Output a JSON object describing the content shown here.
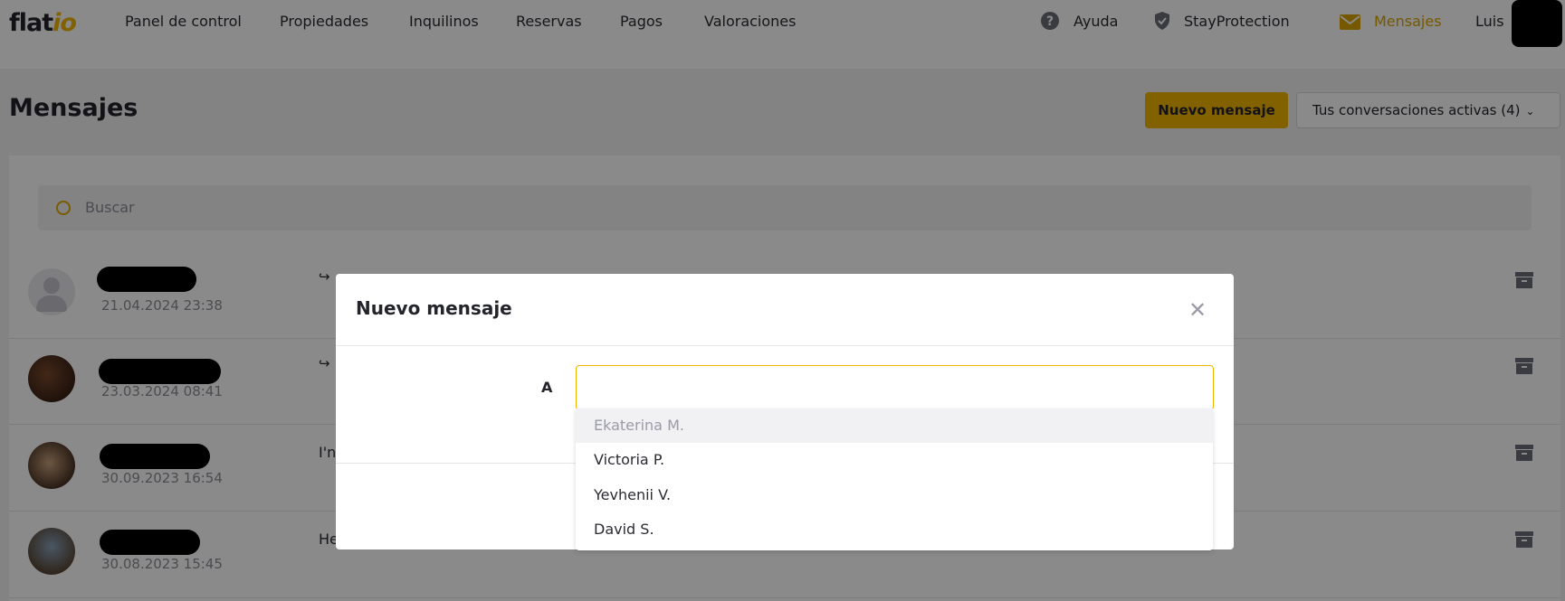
{
  "logo": {
    "main": "flat",
    "accent": "io"
  },
  "nav": {
    "items": [
      "Panel de control",
      "Propiedades",
      "Inquilinos",
      "Reservas",
      "Pagos",
      "Valoraciones"
    ],
    "help": "Ayuda",
    "protection": "StayProtection",
    "messages": "Mensajes",
    "user": "Luis"
  },
  "page": {
    "title": "Mensajes",
    "new_message_button": "Nuevo mensaje",
    "conversations_select": "Tus conversaciones activas (4)"
  },
  "search": {
    "placeholder": "Buscar"
  },
  "conversations": [
    {
      "date": "21.04.2024 23:38",
      "preview": "↪"
    },
    {
      "date": "23.03.2024 08:41",
      "preview": "↪"
    },
    {
      "date": "30.09.2023 16:54",
      "preview": "I'n"
    },
    {
      "date": "30.08.2023 15:45",
      "preview": "He"
    }
  ],
  "modal": {
    "title": "Nuevo mensaje",
    "to_label": "A",
    "to_value": "",
    "suggestions": [
      "Ekaterina M.",
      "Victoria P.",
      "Yevhenii V.",
      "David S."
    ]
  },
  "colors": {
    "accent": "#f0b400",
    "text": "#2b2b33"
  },
  "icons": {
    "help": "question-circle-icon",
    "protection": "shield-check-icon",
    "messages": "envelope-icon",
    "search": "search-icon",
    "archive": "archive-icon",
    "close": "close-icon"
  }
}
